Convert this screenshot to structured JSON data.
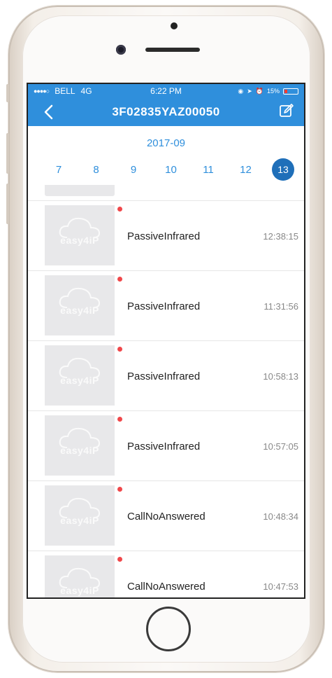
{
  "status_bar": {
    "carrier": "BELL",
    "network": "4G",
    "time": "6:22 PM",
    "battery": "15%"
  },
  "nav": {
    "title": "3F02835YAZ00050",
    "back_icon": "chevron-left-icon",
    "edit_icon": "edit-icon"
  },
  "calendar": {
    "month": "2017-09",
    "days": [
      "7",
      "8",
      "9",
      "10",
      "11",
      "12",
      "13"
    ],
    "selected_day": "13"
  },
  "events": [
    {
      "type": "PassiveInfrared",
      "time": "12:38:15",
      "thumbnail_watermark": "easy4iP",
      "unread": true
    },
    {
      "type": "PassiveInfrared",
      "time": "11:31:56",
      "thumbnail_watermark": "easy4iP",
      "unread": true
    },
    {
      "type": "PassiveInfrared",
      "time": "10:58:13",
      "thumbnail_watermark": "easy4iP",
      "unread": true
    },
    {
      "type": "PassiveInfrared",
      "time": "10:57:05",
      "thumbnail_watermark": "easy4iP",
      "unread": true
    },
    {
      "type": "CallNoAnswered",
      "time": "10:48:34",
      "thumbnail_watermark": "easy4iP",
      "unread": true
    },
    {
      "type": "CallNoAnswered",
      "time": "10:47:53",
      "thumbnail_watermark": "easy4iP",
      "unread": true
    }
  ],
  "colors": {
    "accent": "#2f8fdc",
    "selected_day": "#1f6fb9",
    "unread_dot": "#f0474a"
  }
}
